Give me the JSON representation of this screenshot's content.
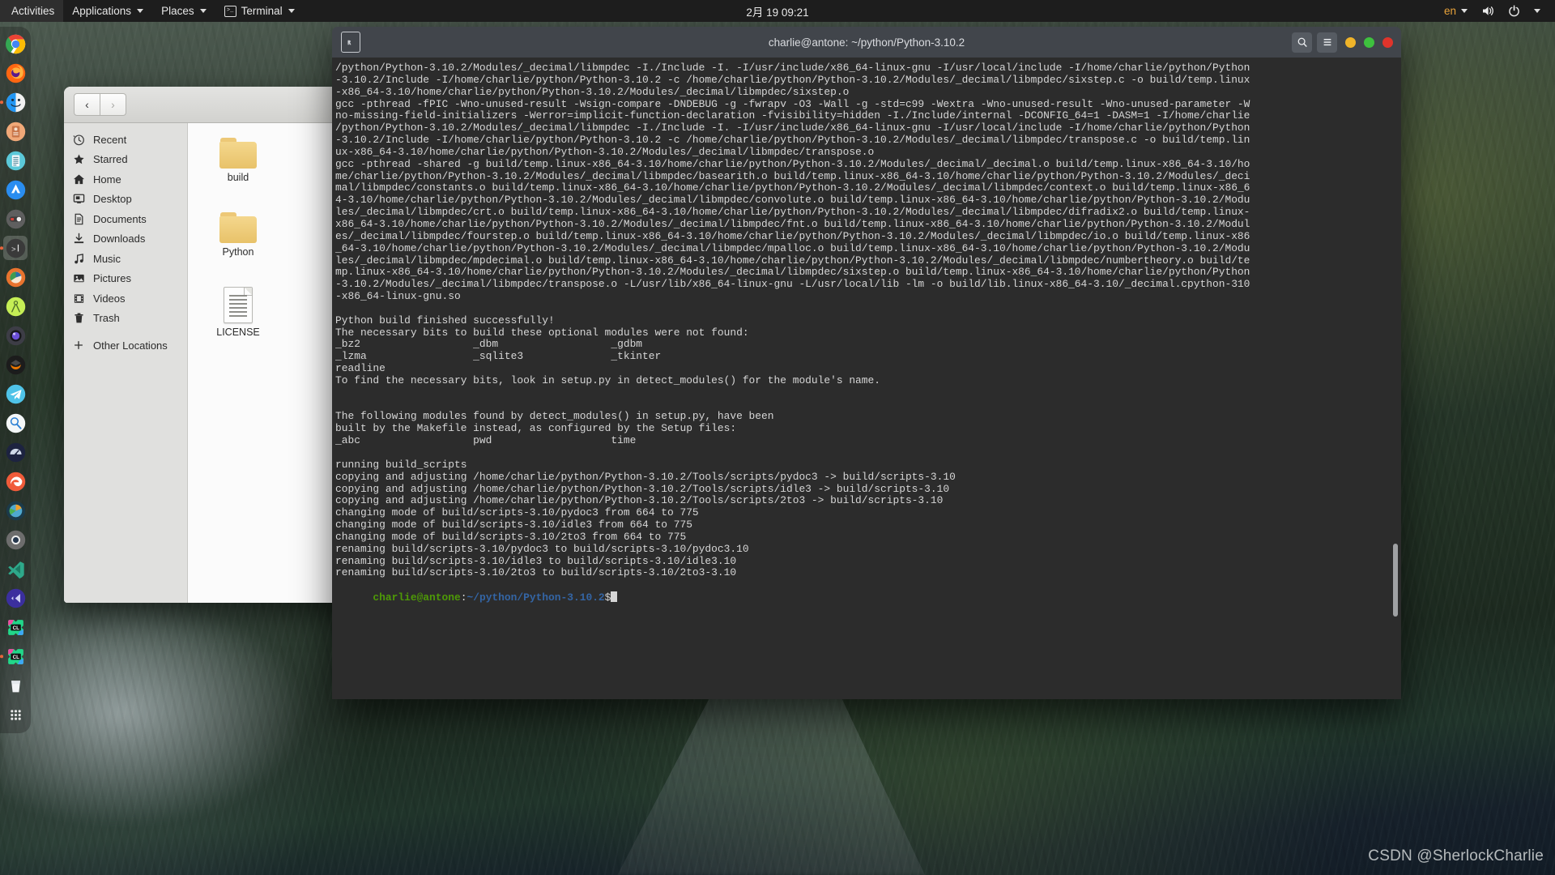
{
  "topbar": {
    "activities": "Activities",
    "applications": "Applications",
    "places": "Places",
    "app_name": "Terminal",
    "clock": "2月 19 09:21",
    "language": "en",
    "icons": {
      "terminal": "terminal-icon",
      "volume": "volume-icon",
      "power": "power-icon"
    }
  },
  "dock": {
    "items": [
      {
        "name": "google-chrome",
        "label": "Google Chrome"
      },
      {
        "name": "firefox",
        "label": "Firefox"
      },
      {
        "name": "files",
        "label": "Files"
      },
      {
        "name": "software-updater",
        "label": "Software Updater"
      },
      {
        "name": "text-editor",
        "label": "Text Editor"
      },
      {
        "name": "app-store",
        "label": "App Store"
      },
      {
        "name": "toggle-settings",
        "label": "Settings Toggle"
      },
      {
        "name": "terminal",
        "label": "Terminal"
      },
      {
        "name": "disk-usage",
        "label": "Disk Usage Analyzer"
      },
      {
        "name": "drawing-compass",
        "label": "Drawing"
      },
      {
        "name": "camera",
        "label": "Camera"
      },
      {
        "name": "blender",
        "label": "Blender"
      },
      {
        "name": "telegram",
        "label": "Telegram"
      },
      {
        "name": "search-tool",
        "label": "Search"
      },
      {
        "name": "system-monitor",
        "label": "System Monitor"
      },
      {
        "name": "edge-browser",
        "label": "Microsoft Edge"
      },
      {
        "name": "pie-app",
        "label": "Disk Analyzer"
      },
      {
        "name": "settings-disc",
        "label": "Settings"
      },
      {
        "name": "vs-code",
        "label": "Visual Studio Code"
      },
      {
        "name": "vs-code-insiders",
        "label": "VS Code Insiders"
      },
      {
        "name": "clion-1",
        "label": "CLion"
      },
      {
        "name": "clion-2",
        "label": "CLion"
      },
      {
        "name": "trash",
        "label": "Trash"
      },
      {
        "name": "show-applications",
        "label": "Show Applications"
      }
    ]
  },
  "files_window": {
    "nav": {
      "back": "‹",
      "forward": "›"
    },
    "sidebar": [
      {
        "label": "Recent",
        "icon": "clock-icon"
      },
      {
        "label": "Starred",
        "icon": "star-icon"
      },
      {
        "label": "Home",
        "icon": "home-icon"
      },
      {
        "label": "Desktop",
        "icon": "desktop-icon"
      },
      {
        "label": "Documents",
        "icon": "document-icon"
      },
      {
        "label": "Downloads",
        "icon": "download-icon"
      },
      {
        "label": "Music",
        "icon": "music-icon"
      },
      {
        "label": "Pictures",
        "icon": "picture-icon"
      },
      {
        "label": "Videos",
        "icon": "video-icon"
      },
      {
        "label": "Trash",
        "icon": "trash-icon"
      }
    ],
    "other_locations": {
      "label": "Other Locations",
      "icon": "plus-icon"
    },
    "files": [
      {
        "label": "build",
        "type": "folder"
      },
      {
        "label": "Python",
        "type": "folder"
      },
      {
        "label": "LICENSE",
        "type": "document"
      }
    ]
  },
  "terminal": {
    "title": "charlie@antone: ~/python/Python-3.10.2",
    "buttons": {
      "search": "search-icon",
      "menu": "hamburger-menu-icon",
      "minimize": "minimize-button",
      "maximize": "maximize-button",
      "close": "close-button"
    },
    "colors": {
      "minimize": "#f0b429",
      "maximize": "#3ec13e",
      "close": "#e0342b",
      "prompt_user": "#4e9a06",
      "prompt_path": "#3465a4",
      "background": "#2c2c2c",
      "foreground": "#d6d6d6"
    },
    "output": "/python/Python-3.10.2/Modules/_decimal/libmpdec -I./Include -I. -I/usr/include/x86_64-linux-gnu -I/usr/local/include -I/home/charlie/python/Python\n-3.10.2/Include -I/home/charlie/python/Python-3.10.2 -c /home/charlie/python/Python-3.10.2/Modules/_decimal/libmpdec/sixstep.c -o build/temp.linux\n-x86_64-3.10/home/charlie/python/Python-3.10.2/Modules/_decimal/libmpdec/sixstep.o\ngcc -pthread -fPIC -Wno-unused-result -Wsign-compare -DNDEBUG -g -fwrapv -O3 -Wall -g -std=c99 -Wextra -Wno-unused-result -Wno-unused-parameter -W\nno-missing-field-initializers -Werror=implicit-function-declaration -fvisibility=hidden -I./Include/internal -DCONFIG_64=1 -DASM=1 -I/home/charlie\n/python/Python-3.10.2/Modules/_decimal/libmpdec -I./Include -I. -I/usr/include/x86_64-linux-gnu -I/usr/local/include -I/home/charlie/python/Python\n-3.10.2/Include -I/home/charlie/python/Python-3.10.2 -c /home/charlie/python/Python-3.10.2/Modules/_decimal/libmpdec/transpose.c -o build/temp.lin\nux-x86_64-3.10/home/charlie/python/Python-3.10.2/Modules/_decimal/libmpdec/transpose.o\ngcc -pthread -shared -g build/temp.linux-x86_64-3.10/home/charlie/python/Python-3.10.2/Modules/_decimal/_decimal.o build/temp.linux-x86_64-3.10/ho\nme/charlie/python/Python-3.10.2/Modules/_decimal/libmpdec/basearith.o build/temp.linux-x86_64-3.10/home/charlie/python/Python-3.10.2/Modules/_deci\nmal/libmpdec/constants.o build/temp.linux-x86_64-3.10/home/charlie/python/Python-3.10.2/Modules/_decimal/libmpdec/context.o build/temp.linux-x86_6\n4-3.10/home/charlie/python/Python-3.10.2/Modules/_decimal/libmpdec/convolute.o build/temp.linux-x86_64-3.10/home/charlie/python/Python-3.10.2/Modu\nles/_decimal/libmpdec/crt.o build/temp.linux-x86_64-3.10/home/charlie/python/Python-3.10.2/Modules/_decimal/libmpdec/difradix2.o build/temp.linux-\nx86_64-3.10/home/charlie/python/Python-3.10.2/Modules/_decimal/libmpdec/fnt.o build/temp.linux-x86_64-3.10/home/charlie/python/Python-3.10.2/Modul\nes/_decimal/libmpdec/fourstep.o build/temp.linux-x86_64-3.10/home/charlie/python/Python-3.10.2/Modules/_decimal/libmpdec/io.o build/temp.linux-x86\n_64-3.10/home/charlie/python/Python-3.10.2/Modules/_decimal/libmpdec/mpalloc.o build/temp.linux-x86_64-3.10/home/charlie/python/Python-3.10.2/Modu\nles/_decimal/libmpdec/mpdecimal.o build/temp.linux-x86_64-3.10/home/charlie/python/Python-3.10.2/Modules/_decimal/libmpdec/numbertheory.o build/te\nmp.linux-x86_64-3.10/home/charlie/python/Python-3.10.2/Modules/_decimal/libmpdec/sixstep.o build/temp.linux-x86_64-3.10/home/charlie/python/Python\n-3.10.2/Modules/_decimal/libmpdec/transpose.o -L/usr/lib/x86_64-linux-gnu -L/usr/local/lib -lm -o build/lib.linux-x86_64-3.10/_decimal.cpython-310\n-x86_64-linux-gnu.so\n\nPython build finished successfully!\nThe necessary bits to build these optional modules were not found:\n_bz2                  _dbm                  _gdbm\n_lzma                 _sqlite3              _tkinter\nreadline\nTo find the necessary bits, look in setup.py in detect_modules() for the module's name.\n\n\nThe following modules found by detect_modules() in setup.py, have been\nbuilt by the Makefile instead, as configured by the Setup files:\n_abc                  pwd                   time\n\nrunning build_scripts\ncopying and adjusting /home/charlie/python/Python-3.10.2/Tools/scripts/pydoc3 -> build/scripts-3.10\ncopying and adjusting /home/charlie/python/Python-3.10.2/Tools/scripts/idle3 -> build/scripts-3.10\ncopying and adjusting /home/charlie/python/Python-3.10.2/Tools/scripts/2to3 -> build/scripts-3.10\nchanging mode of build/scripts-3.10/pydoc3 from 664 to 775\nchanging mode of build/scripts-3.10/idle3 from 664 to 775\nchanging mode of build/scripts-3.10/2to3 from 664 to 775\nrenaming build/scripts-3.10/pydoc3 to build/scripts-3.10/pydoc3.10\nrenaming build/scripts-3.10/idle3 to build/scripts-3.10/idle3.10\nrenaming build/scripts-3.10/2to3 to build/scripts-3.10/2to3-3.10",
    "prompt": {
      "user_host": "charlie@antone",
      "separator": ":",
      "path": "~/python/Python-3.10.2",
      "symbol": "$"
    }
  },
  "watermark": "CSDN @SherlockCharlie"
}
